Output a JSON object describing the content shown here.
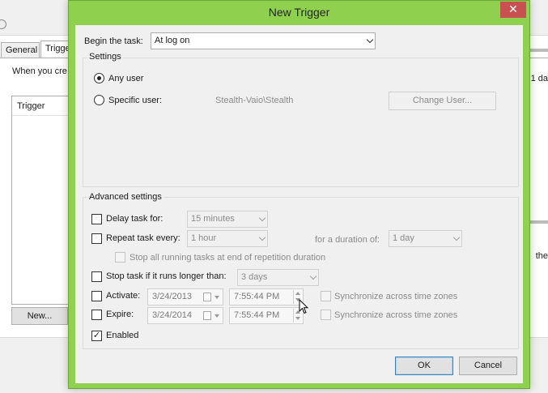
{
  "background_window": {
    "tabs": [
      "General",
      "Trigge"
    ],
    "description": "When you cre",
    "list_header": "Trigger",
    "new_button": "New...",
    "right_fragment_top": "1 da",
    "right_fragment_bottom": "the"
  },
  "dialog": {
    "title": "New Trigger",
    "close_label": "✕",
    "begin_label": "Begin the task:",
    "begin_value": "At log on",
    "settings": {
      "title": "Settings",
      "any_user": "Any user",
      "specific_user": "Specific user:",
      "user_value": "Stealth-Vaio\\Stealth",
      "change_user": "Change User..."
    },
    "advanced": {
      "title": "Advanced settings",
      "delay_label": "Delay task for:",
      "delay_value": "15 minutes",
      "repeat_label": "Repeat task every:",
      "repeat_value": "1 hour",
      "duration_label": "for a duration of:",
      "duration_value": "1 day",
      "stop_running_label": "Stop all running tasks at end of repetition duration",
      "stop_longer_label": "Stop task if it runs longer than:",
      "stop_longer_value": "3 days",
      "activate_label": "Activate:",
      "activate_date": "3/24/2013",
      "activate_time": "7:55:44 PM",
      "activate_sync": "Synchronize across time zones",
      "expire_label": "Expire:",
      "expire_date": "3/24/2014",
      "expire_time": "7:55:44 PM",
      "expire_sync": "Synchronize across time zones",
      "enabled_label": "Enabled",
      "enabled_check": "✓"
    },
    "ok": "OK",
    "cancel": "Cancel"
  },
  "colors": {
    "dialog_frame": "#8fd14f",
    "close_button": "#c75050",
    "client_bg": "#f0f0f0"
  }
}
